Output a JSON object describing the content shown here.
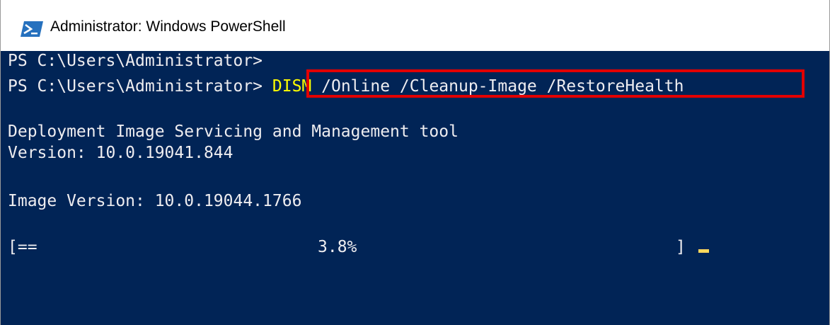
{
  "window": {
    "title": "Administrator: Windows PowerShell",
    "icon": "powershell-icon"
  },
  "console": {
    "prompt_line_1": "PS C:\\Users\\Administrator>",
    "prompt_line_2": "PS C:\\Users\\Administrator>",
    "command_keyword": "DISM",
    "command_args": " /Online /Cleanup-Image /RestoreHealth",
    "output_tool": "Deployment Image Servicing and Management tool",
    "output_version": "Version: 10.0.19041.844",
    "output_image_version": "Image Version: 10.0.19044.1766",
    "progress_open": "[==",
    "progress_percent": "3.8%",
    "progress_close": "]",
    "progress_value": 3.8
  },
  "colors": {
    "console_bg": "#012456",
    "console_text": "#eeedf0",
    "command_keyword": "#ffff00",
    "highlight_border": "#e20000",
    "cursor": "#ffd85c"
  }
}
